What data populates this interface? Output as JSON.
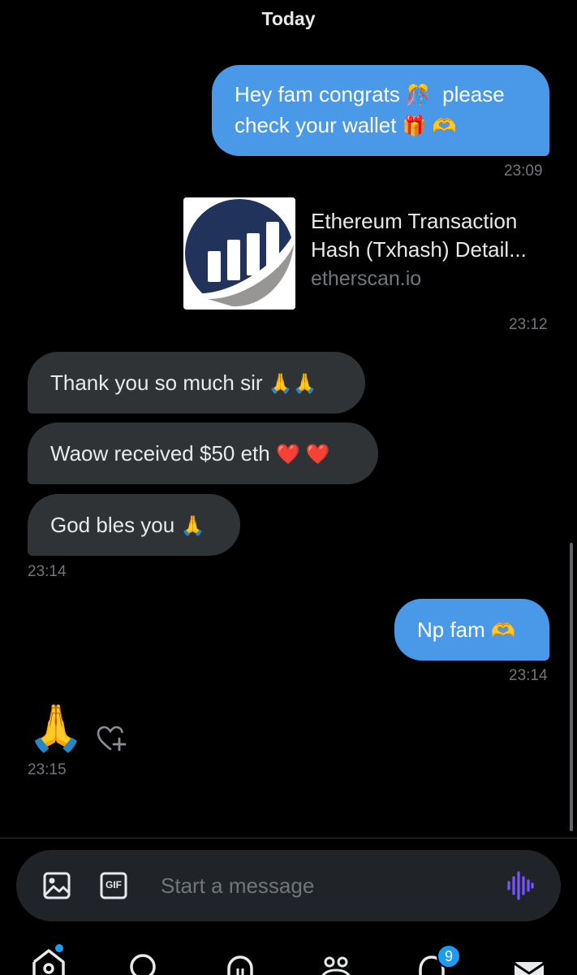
{
  "date_header": "Today",
  "messages": [
    {
      "text_line1": "Hey fam congrats",
      "emoji_a": "🎊",
      "text_line1b": "please",
      "text_line2": "check your wallet",
      "emoji_b": "🎁",
      "emoji_c": "🫶",
      "time": "23:09"
    },
    {
      "link_title_1": "Ethereum Transaction",
      "link_title_2": "Hash (Txhash) Detail...",
      "link_domain": "etherscan.io",
      "time": "23:12"
    },
    {
      "text": "Thank you so much sir",
      "emoji": "🙏🙏"
    },
    {
      "text": "Waow received $50 eth",
      "emoji": "❤️ ❤️"
    },
    {
      "text": "God bles you",
      "emoji": "🙏",
      "time": "23:14"
    },
    {
      "text": "Np fam",
      "emoji": "🫶",
      "time": "23:14"
    },
    {
      "emoji": "🙏",
      "time": "23:15"
    }
  ],
  "composer": {
    "placeholder": "Start a message",
    "gif_label": "GIF"
  },
  "nav": {
    "notifications_badge": "9"
  },
  "colors": {
    "sent_bubble": "#4a99e9",
    "received_bubble": "#2f3336",
    "accent": "#1d9bf0",
    "voice_icon": "#7856ff"
  },
  "icons": [
    "image-icon",
    "gif-icon",
    "voice-icon",
    "home-icon",
    "search-icon",
    "spaces-icon",
    "communities-icon",
    "bell-icon",
    "mail-icon",
    "heart-plus-icon"
  ]
}
